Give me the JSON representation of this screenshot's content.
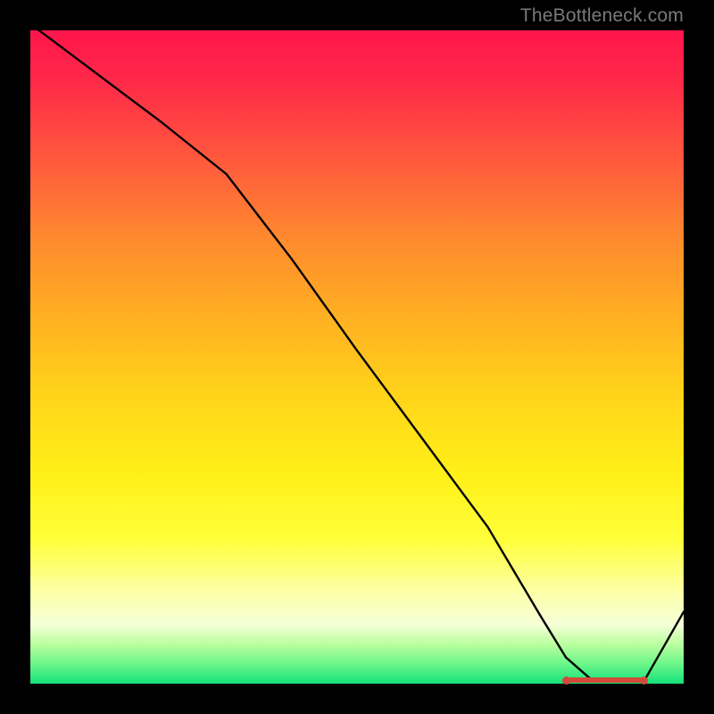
{
  "watermark": "TheBottleneck.com",
  "chart_data": {
    "type": "line",
    "title": "",
    "xlabel": "",
    "ylabel": "",
    "xlim": [
      0,
      100
    ],
    "ylim": [
      0,
      100
    ],
    "series": [
      {
        "name": "curve",
        "x": [
          0,
          10,
          20,
          30,
          40,
          50,
          60,
          70,
          78,
          82,
          86,
          90,
          94,
          100
        ],
        "y": [
          101,
          93.5,
          86,
          78,
          65,
          51,
          37.5,
          24,
          10.5,
          4,
          0.5,
          0.5,
          0.5,
          11
        ]
      }
    ],
    "flat_segment": {
      "x_start": 82,
      "x_end": 94,
      "y": 0.5
    },
    "colors": {
      "curve": "#000000",
      "marker": "#d44a3a",
      "gradient_top": "#ff154c",
      "gradient_bottom": "#14e27a",
      "background": "#000000"
    }
  }
}
